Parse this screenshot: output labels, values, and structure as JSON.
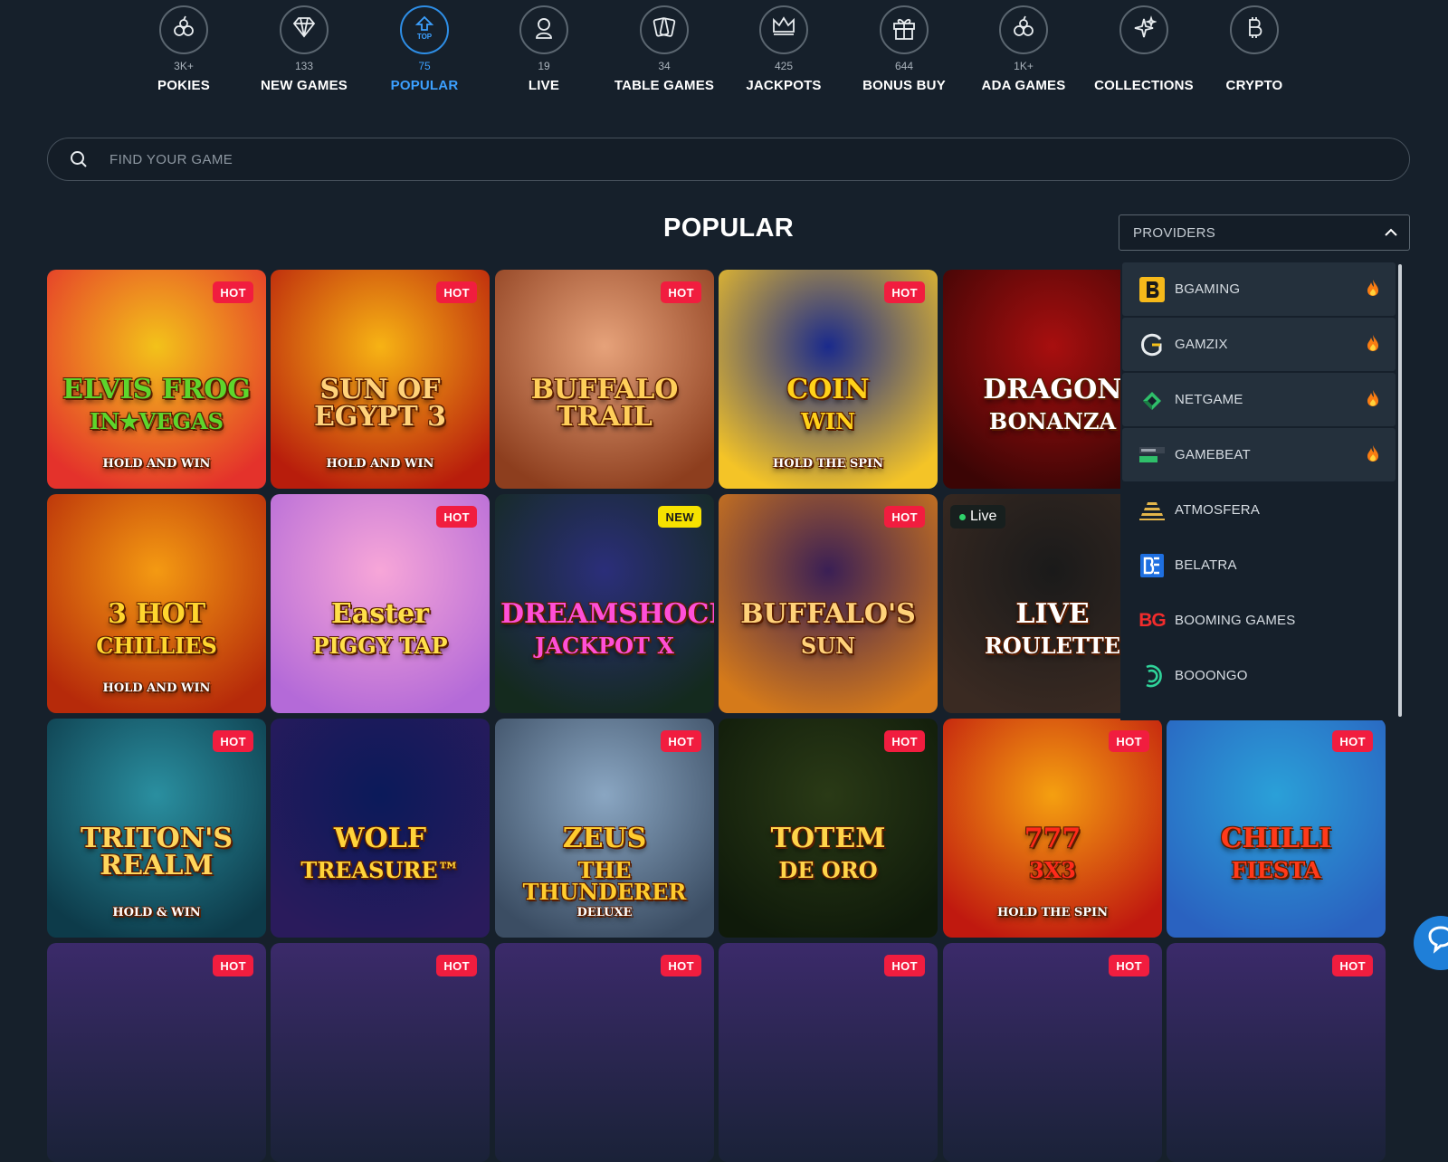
{
  "nav": {
    "items": [
      {
        "label": "POKIES",
        "count": "3K+",
        "icon": "cherries-icon"
      },
      {
        "label": "NEW GAMES",
        "count": "133",
        "icon": "diamond-icon"
      },
      {
        "label": "POPULAR",
        "count": "75",
        "icon": "top-arrow-icon",
        "icon_text": "TOP",
        "active": true
      },
      {
        "label": "LIVE",
        "count": "19",
        "icon": "dealer-icon"
      },
      {
        "label": "TABLE GAMES",
        "count": "34",
        "icon": "cards-icon"
      },
      {
        "label": "JACKPOTS",
        "count": "425",
        "icon": "crown-icon"
      },
      {
        "label": "BONUS BUY",
        "count": "644",
        "icon": "gift-icon"
      },
      {
        "label": "ADA GAMES",
        "count": "1K+",
        "icon": "cherries-icon"
      },
      {
        "label": "COLLECTIONS",
        "count": "",
        "icon": "sparkles-icon"
      },
      {
        "label": "CRYPTO",
        "count": "",
        "icon": "bitcoin-icon"
      }
    ]
  },
  "search": {
    "placeholder": "FIND YOUR GAME"
  },
  "section": {
    "title": "POPULAR"
  },
  "providers": {
    "label": "PROVIDERS",
    "items": [
      {
        "name": "BGAMING",
        "hot": true,
        "logo": "bgaming-logo"
      },
      {
        "name": "GAMZIX",
        "hot": true,
        "logo": "gamzix-logo"
      },
      {
        "name": "NETGAME",
        "hot": true,
        "logo": "netgame-logo"
      },
      {
        "name": "GAMEBEAT",
        "hot": true,
        "logo": "gamebeat-logo"
      },
      {
        "name": "ATMOSFERA",
        "hot": false,
        "logo": "atmosfera-logo"
      },
      {
        "name": "BELATRA",
        "hot": false,
        "logo": "belatra-logo"
      },
      {
        "name": "BOOMING GAMES",
        "hot": false,
        "logo": "booming-logo",
        "logo_text": "BG"
      },
      {
        "name": "BOOONGO",
        "hot": false,
        "logo": "booongo-logo"
      }
    ]
  },
  "games": [
    {
      "title": "ELVIS FROG",
      "subtitle": "IN★VEGAS",
      "tagline": "HOLD AND WIN",
      "badge": "HOT",
      "bg": "#f3c21a",
      "bg2": "#e4322b",
      "color": "#5dd62c"
    },
    {
      "title": "SUN OF EGYPT 3",
      "subtitle": "",
      "tagline": "HOLD AND WIN",
      "badge": "HOT",
      "bg": "#f7b314",
      "bg2": "#b81d0c",
      "color": "#ffd27a"
    },
    {
      "title": "BUFFALO TRAIL",
      "subtitle": "",
      "tagline": "",
      "badge": "HOT",
      "bg": "#e6a27a",
      "bg2": "#8d3e1e",
      "color": "#ffcf5a"
    },
    {
      "title": "COIN",
      "subtitle": "WIN",
      "tagline": "HOLD THE SPIN",
      "badge": "HOT",
      "bg": "#1a2a8c",
      "bg2": "#f4c427",
      "color": "#ffd21a"
    },
    {
      "title": "DRAGON",
      "subtitle": "BONANZA",
      "tagline": "",
      "badge": "",
      "bg": "#a80f0f",
      "bg2": "#3b0505",
      "color": "#ffffff"
    },
    {
      "title": "",
      "subtitle": "",
      "tagline": "",
      "badge": "",
      "bg": "#1b2b3a",
      "bg2": "#16202b",
      "color": "#ffffff"
    },
    {
      "title": "3 HOT",
      "subtitle": "CHILLIES",
      "tagline": "HOLD AND WIN",
      "badge": "",
      "bg": "#f49a12",
      "bg2": "#b62a0a",
      "color": "#ffd62e"
    },
    {
      "title": "Easter",
      "subtitle": "PIGGY TAP",
      "tagline": "",
      "badge": "HOT",
      "bg": "#f7a6d8",
      "bg2": "#b46ad8",
      "color": "#ffe04a"
    },
    {
      "title": "DREAMSHOCK",
      "subtitle": "JACKPOT X",
      "tagline": "",
      "badge": "NEW",
      "bg": "#2b2e7a",
      "bg2": "#142a1e",
      "color": "#ff4fd8"
    },
    {
      "title": "BUFFALO'S",
      "subtitle": "SUN",
      "tagline": "",
      "badge": "HOT",
      "bg": "#3a1f55",
      "bg2": "#d57a1a",
      "color": "#ffd27a"
    },
    {
      "title": "LIVE",
      "subtitle": "ROULETTE",
      "tagline": "",
      "badge": "",
      "live": "Live",
      "bg": "#1a1a1a",
      "bg2": "#3a2a22",
      "color": "#ffffff"
    },
    {
      "title": "",
      "subtitle": "",
      "tagline": "",
      "badge": "",
      "bg": "#1b2b3a",
      "bg2": "#16202b",
      "color": "#ffffff"
    },
    {
      "title": "TRITON'S REALM",
      "subtitle": "",
      "tagline": "HOLD & WIN",
      "badge": "HOT",
      "bg": "#2a8fa0",
      "bg2": "#0d3b4a",
      "color": "#ffd65c"
    },
    {
      "title": "WOLF",
      "subtitle": "TREASURE™",
      "tagline": "",
      "badge": "",
      "bg": "#0b1a5a",
      "bg2": "#2a1b5c",
      "color": "#ffd43a"
    },
    {
      "title": "ZEUS",
      "subtitle": "THE THUNDERER",
      "tagline": "DELUXE",
      "badge": "HOT",
      "bg": "#8aa6c2",
      "bg2": "#3b4d63",
      "color": "#ffcc2e"
    },
    {
      "title": "TOTEM",
      "subtitle": "DE ORO",
      "tagline": "",
      "badge": "HOT",
      "bg": "#2a3a16",
      "bg2": "#0f1a0a",
      "color": "#ffd54a"
    },
    {
      "title": "777",
      "subtitle": "3X3",
      "tagline": "HOLD THE SPIN",
      "badge": "HOT",
      "bg": "#f5a010",
      "bg2": "#c0190f",
      "color": "#ff2a1a"
    },
    {
      "title": "CHILLI",
      "subtitle": "FIESTA",
      "tagline": "",
      "badge": "HOT",
      "bg": "#2aa0d8",
      "bg2": "#2a62c0",
      "color": "#ff3a1a"
    }
  ],
  "bottom_row_badges": [
    "HOT",
    "HOT",
    "HOT",
    "HOT",
    "HOT",
    "HOT"
  ]
}
